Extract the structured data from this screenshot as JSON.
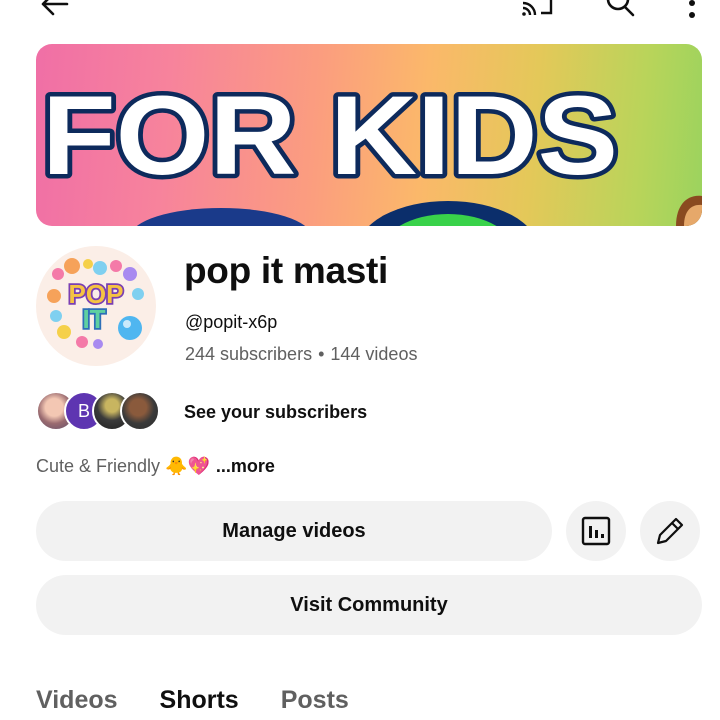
{
  "topbar": {
    "icons": [
      "back-arrow-icon",
      "cast-icon",
      "search-icon",
      "more-vert-icon"
    ]
  },
  "banner": {
    "text": "FOR KIDS"
  },
  "avatar": {
    "text_top": "POP",
    "text_bottom": "IT"
  },
  "channel": {
    "name": "pop it masti",
    "handle": "@popit-x6p",
    "subscribers": "244 subscribers",
    "separator": "•",
    "videos": "144 videos"
  },
  "subscribers_row": {
    "initial": "B",
    "label": "See your subscribers"
  },
  "description": {
    "text": "Cute & Friendly 🐥💖",
    "more": "...more"
  },
  "buttons": {
    "manage": "Manage videos",
    "community": "Visit Community"
  },
  "tabs": [
    {
      "label": "Videos",
      "active": false
    },
    {
      "label": "Shorts",
      "active": true
    },
    {
      "label": "Posts",
      "active": false
    }
  ],
  "colors": {
    "button_bg": "#f2f2f2",
    "secondary_text": "#606060",
    "avatar_initial_bg": "#5e35b1"
  }
}
